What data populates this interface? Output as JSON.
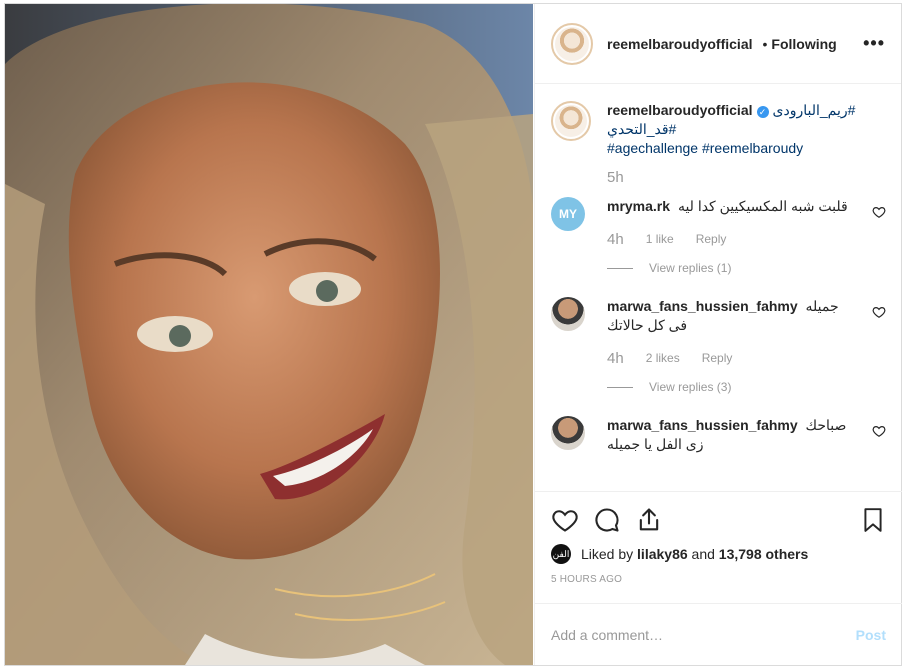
{
  "post": {
    "username": "reemelbaroudyofficial",
    "dot": "•",
    "following_label": "Following",
    "more_label": "•••"
  },
  "caption": {
    "username": "reemelbaroudyofficial",
    "verified": "✓",
    "line1": "#ريم_البارودى",
    "line2": "#قد_التحدي",
    "line3": "#agechallenge #reemelbaroudy",
    "time": "5h"
  },
  "comments": [
    {
      "username": "mryma.rk",
      "text": "قلبت شبه المكسيكيين كدا ليه",
      "time": "4h",
      "likes": "1 like",
      "reply": "Reply",
      "view_replies": "View replies (1)",
      "avatar_text": "MY"
    },
    {
      "username": "marwa_fans_hussien_fahmy",
      "text": "جميله",
      "text2": "فى كل حالاتك",
      "time": "4h",
      "likes": "2 likes",
      "reply": "Reply",
      "view_replies": "View replies (3)"
    },
    {
      "username": "marwa_fans_hussien_fahmy",
      "text": "صباحك",
      "text2": "زى الفل يا جميله"
    }
  ],
  "actions": {
    "liked_by_prefix": "Liked by",
    "liked_by_user": "lilaky86",
    "liked_by_and": "and",
    "liked_by_count": "13,798 others",
    "liker_avatar_text": "الفن",
    "time_ago": "5 HOURS AGO"
  },
  "add_comment": {
    "placeholder": "Add a comment…",
    "post_label": "Post"
  }
}
